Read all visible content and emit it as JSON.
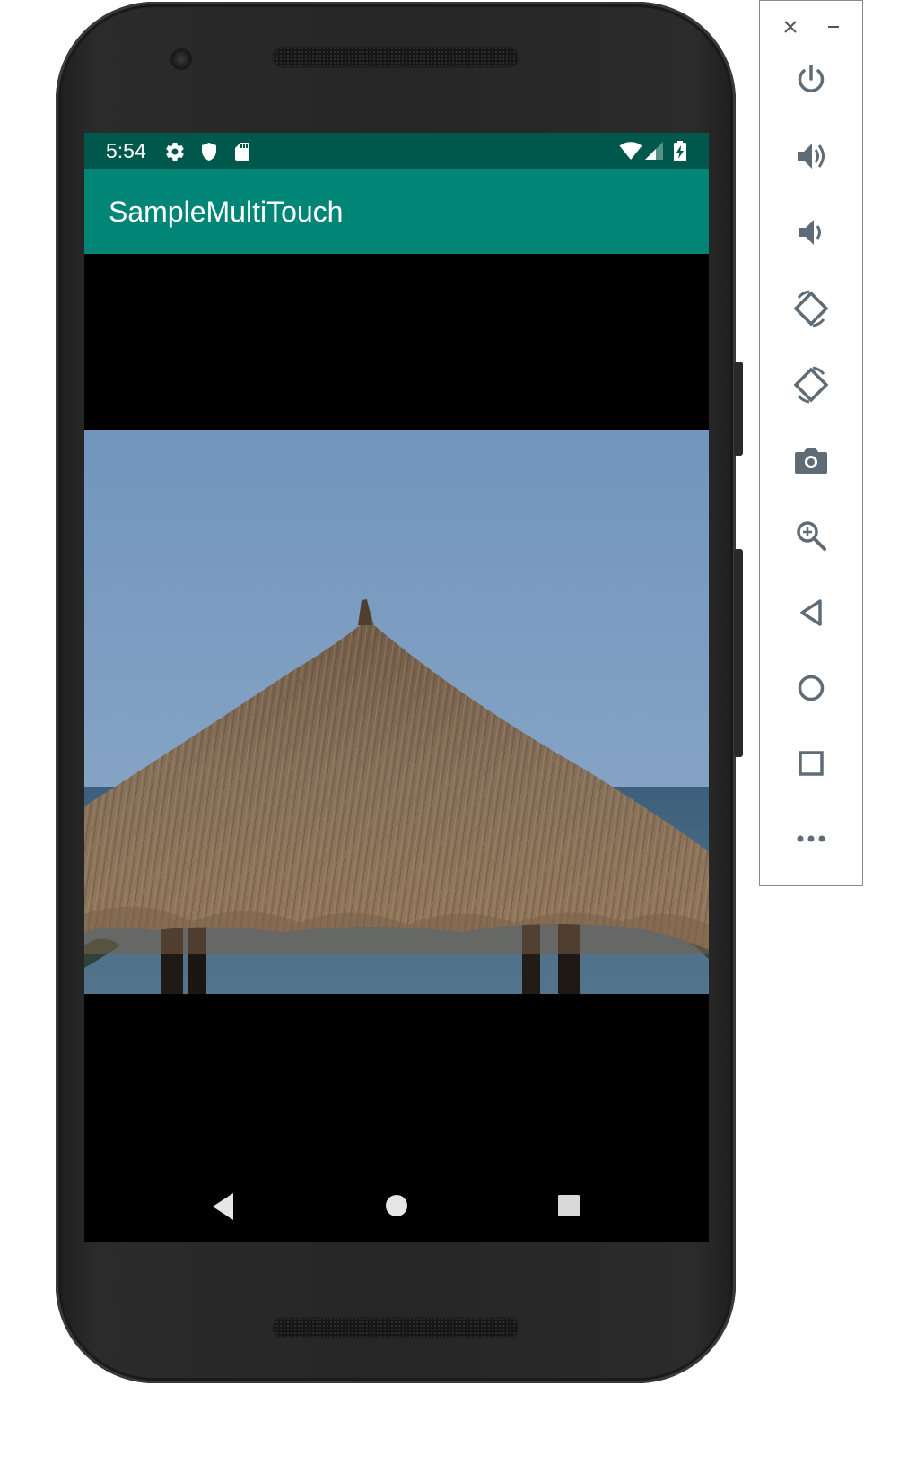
{
  "status_bar": {
    "time": "5:54",
    "left_icons": [
      "settings-icon",
      "shield-icon",
      "sd-card-icon"
    ],
    "right_icons": [
      "wifi-icon",
      "signal-icon",
      "battery-charging-icon"
    ]
  },
  "app_bar": {
    "title": "SampleMultiTouch",
    "color": "#008577",
    "status_color": "#00574b"
  },
  "content": {
    "image_subject": "thatched-umbrella-beach-photo"
  },
  "nav_bar": {
    "buttons": [
      "back",
      "home",
      "recents"
    ]
  },
  "emulator_toolbar": {
    "window_controls": [
      "close",
      "minimize"
    ],
    "tools": [
      "power",
      "volume-up",
      "volume-down",
      "rotate-left",
      "rotate-right",
      "screenshot",
      "zoom",
      "back",
      "home",
      "overview",
      "more"
    ]
  }
}
